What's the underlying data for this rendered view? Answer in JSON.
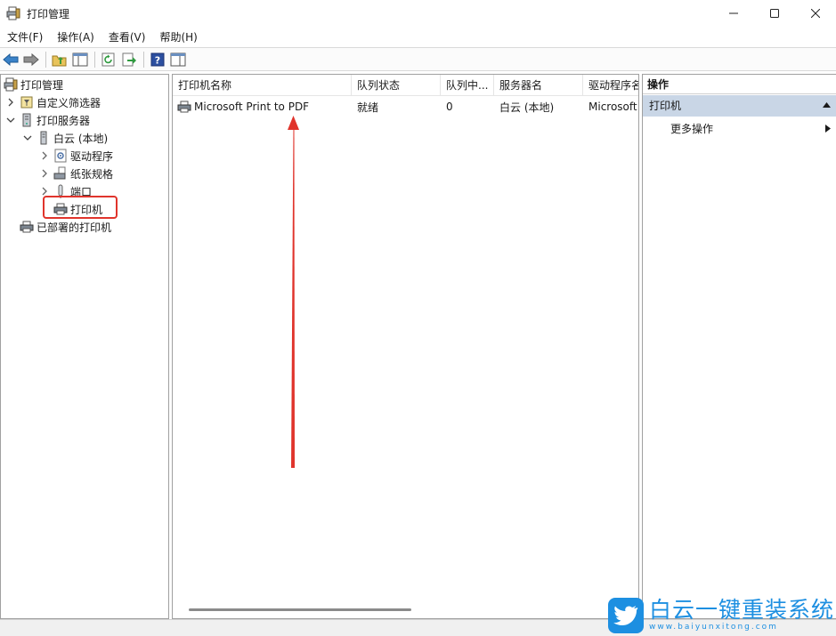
{
  "window": {
    "title": "打印管理"
  },
  "menu": [
    {
      "label": "文件(F)"
    },
    {
      "label": "操作(A)"
    },
    {
      "label": "查看(V)"
    },
    {
      "label": "帮助(H)"
    }
  ],
  "tree": {
    "root": "打印管理",
    "custom_filters": "自定义筛选器",
    "print_servers": "打印服务器",
    "local_server": "白云 (本地)",
    "drivers": "驱动程序",
    "forms": "纸张规格",
    "ports": "端口",
    "printers": "打印机",
    "deployed_printers": "已部署的打印机"
  },
  "list": {
    "columns": [
      "打印机名称",
      "队列状态",
      "队列中...",
      "服务器名",
      "驱动程序名"
    ],
    "rows": [
      {
        "name": "Microsoft Print to PDF",
        "status": "就绪",
        "queued": "0",
        "server": "白云 (本地)",
        "driver": "Microsoft"
      }
    ]
  },
  "actions": {
    "header": "操作",
    "group": "打印机",
    "more": "更多操作"
  },
  "watermark": {
    "title": "白云一键重装系统",
    "url": "www.baiyunxitong.com"
  },
  "colors": {
    "accent_blue": "#1d8fe1",
    "selection": "#c9d6e6",
    "annotation_red": "#e0342c"
  }
}
